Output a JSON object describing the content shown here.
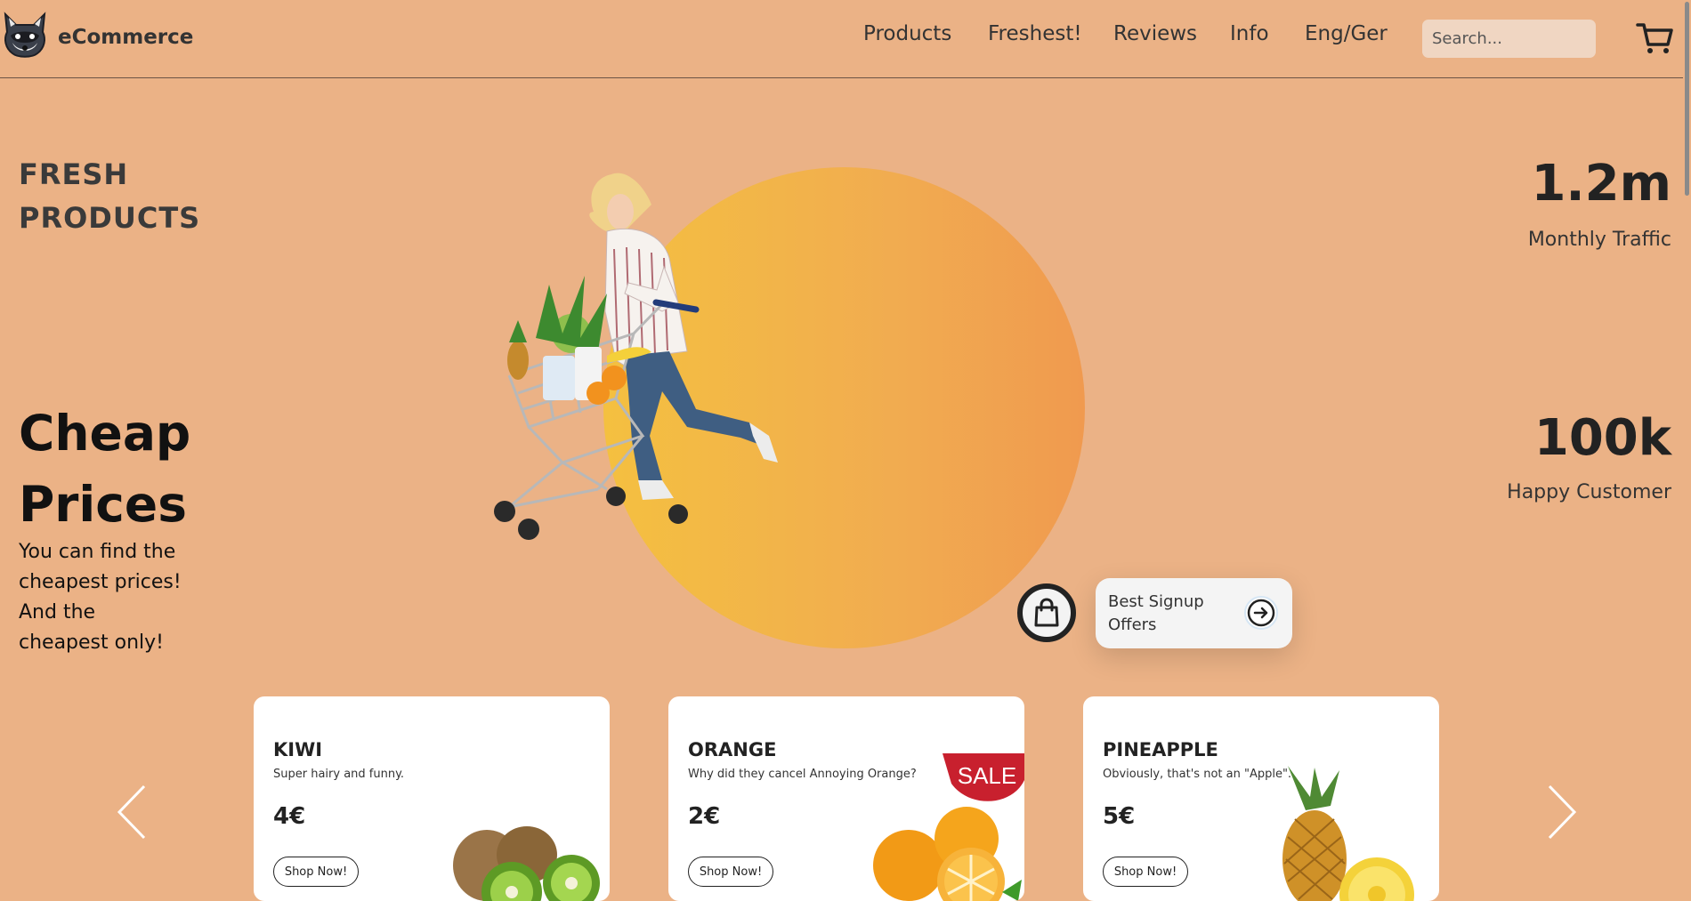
{
  "header": {
    "brand": "eCommerce",
    "nav": [
      "Products",
      "Freshest!",
      "Reviews",
      "Info",
      "Eng/Ger"
    ],
    "search_placeholder": "Search..."
  },
  "hero": {
    "tagline_lines": [
      "FRESH",
      "PRODUCTS"
    ],
    "headline_lines": [
      "Cheap",
      "Prices"
    ],
    "description_lines": [
      "You can find the",
      "cheapest prices!",
      "And the",
      "cheapest only!"
    ],
    "signup_offer": "Best Signup Offers"
  },
  "stats": [
    {
      "value": "1.2m",
      "label": "Monthly Traffic"
    },
    {
      "value": "100k",
      "label": "Happy Customer"
    }
  ],
  "products": [
    {
      "name": "KIWI",
      "description": "Super hairy and funny.",
      "price": "4€",
      "button": "Shop Now!",
      "icon": "kiwi-image"
    },
    {
      "name": "ORANGE",
      "description": "Why did they cancel Annoying Orange?",
      "price": "2€",
      "button": "Shop Now!",
      "badge": "SALE",
      "icon": "orange-image"
    },
    {
      "name": "PINEAPPLE",
      "description": "Obviously, that's not an \"Apple\".",
      "price": "5€",
      "button": "Shop Now!",
      "icon": "pineapple-image"
    }
  ],
  "colors": {
    "background": "#ebb286",
    "circle_start": "#f4c040",
    "circle_end": "#f09a4f",
    "sale": "#c8202e"
  }
}
